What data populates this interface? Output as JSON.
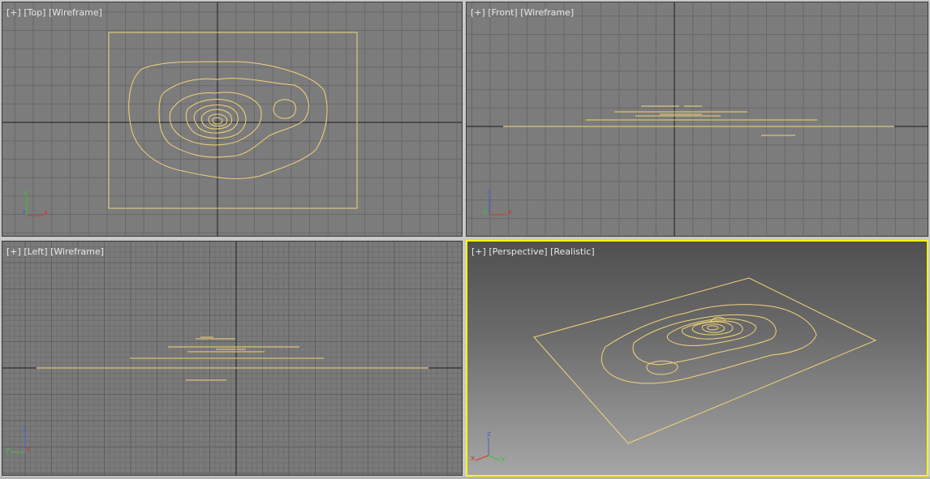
{
  "viewports": {
    "top": {
      "menu": "[+]",
      "view": "[Top]",
      "shading": "[Wireframe]",
      "axes": [
        "y",
        "z",
        "x"
      ]
    },
    "front": {
      "menu": "[+]",
      "view": "[Front]",
      "shading": "[Wireframe]",
      "axes": [
        "z",
        "y",
        "x"
      ]
    },
    "left": {
      "menu": "[+]",
      "view": "[Left]",
      "shading": "[Wireframe]",
      "axes": [
        "z",
        "y",
        "x"
      ]
    },
    "perspective": {
      "menu": "[+]",
      "view": "[Perspective]",
      "shading": "[Realistic]",
      "axes": [
        "z",
        "x",
        "y"
      ],
      "active": true
    }
  },
  "colors": {
    "wire": "#f2d37a",
    "grid_bg": "#7a7a7a",
    "grid_line": "#6a6a6a",
    "axis_line": "#1e1e1e",
    "active_border": "#ffff00",
    "gizmo_x": "#d03a2a",
    "gizmo_y": "#3fbe3f",
    "gizmo_z": "#4a5fd0"
  }
}
